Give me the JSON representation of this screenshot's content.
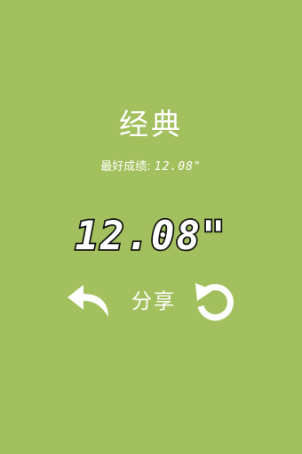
{
  "result": {
    "mode_title": "经典",
    "best_label": "最好成绩:",
    "best_value": "12.08\"",
    "score": "12.08\""
  },
  "controls": {
    "back_icon": "back-arrow-icon",
    "share_label": "分享",
    "restart_icon": "restart-icon"
  },
  "colors": {
    "background": "#a3c05e",
    "text": "#ffffff",
    "score_fill": "#ffffff",
    "score_stroke": "#111111"
  }
}
